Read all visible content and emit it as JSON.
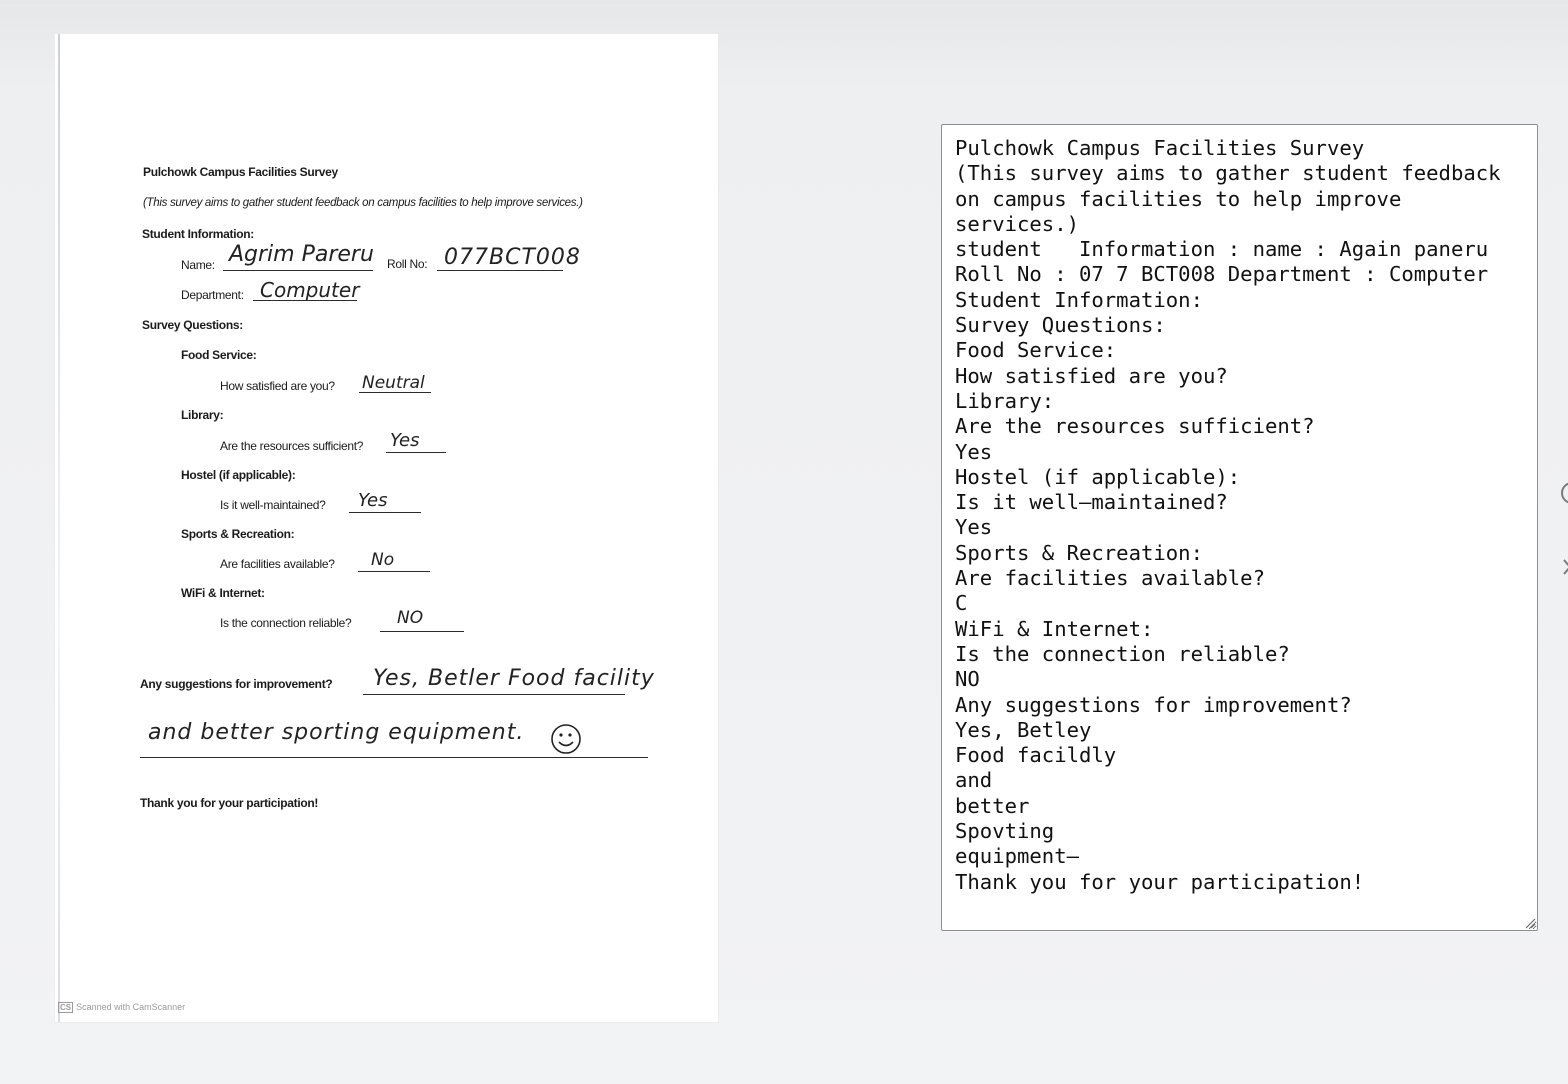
{
  "paper": {
    "title": "Pulchowk Campus Facilities Survey",
    "intro": "(This survey aims to gather student feedback on campus facilities to help improve services.)",
    "student_info_heading": "Student Information:",
    "name_label": "Name:",
    "name_value": "Agrim Pareru",
    "roll_label": "Roll No:",
    "roll_value": "077BCT008",
    "department_label": "Department:",
    "department_value": "Computer",
    "survey_heading": "Survey Questions:",
    "sections": [
      {
        "heading": "Food Service:",
        "question": "How satisfied are you?",
        "answer": "Neutral"
      },
      {
        "heading": "Library:",
        "question": "Are the resources sufficient?",
        "answer": "Yes"
      },
      {
        "heading": "Hostel (if applicable):",
        "question": "Is it well-maintained?",
        "answer": "Yes"
      },
      {
        "heading": "Sports & Recreation:",
        "question": "Are facilities available?",
        "answer": "No"
      },
      {
        "heading": "WiFi & Internet:",
        "question": "Is the connection reliable?",
        "answer": "NO"
      }
    ],
    "suggestion_label": "Any suggestions for improvement?",
    "suggestion_line1": "Yes, Betler Food facility",
    "suggestion_line2": "and better sporting equipment.",
    "thanks": "Thank you for your participation!",
    "scanner_badge": "CS",
    "scanner_text": "Scanned with CamScanner"
  },
  "ocr_output": {
    "text": "Pulchowk Campus Facilities Survey\n(This survey aims to gather student feedback on campus facilities to help improve services.)\nstudent   Information : name : Again paneru   Roll No : 07 7 BCT008 Department : Computer\nStudent Information:\nSurvey Questions:\nFood Service:\nHow satisfied are you?\nLibrary:\nAre the resources sufficient?\nYes\nHostel (if applicable):\nIs it well—maintained?\nYes\nSports & Recreation:\nAre facilities available?\nC\nWiFi & Internet:\nIs the connection reliable?\nNO\nAny suggestions for improvement?\nYes, Betley\nFood facildly\nand\nbetter\nSpovting\nequipment—\nThank you for your participation!"
  },
  "icons": {
    "resize_grip": "resize-grip-icon",
    "edge_icon_top": "partial-circle-icon",
    "edge_icon_bottom": "partial-arrow-icon"
  }
}
